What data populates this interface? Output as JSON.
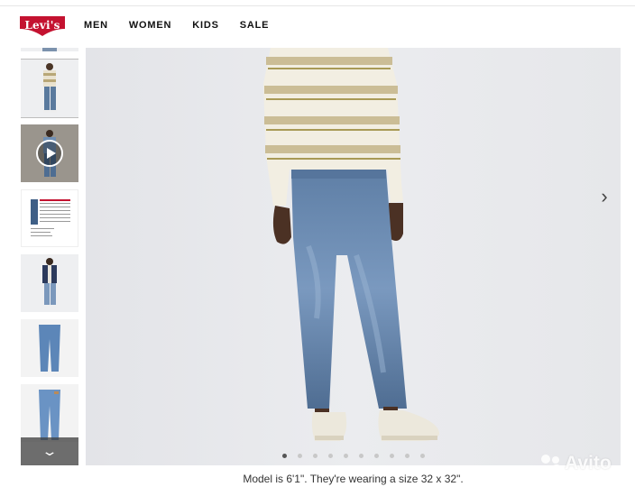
{
  "brand": {
    "logo_text": "Levi's",
    "logo_color": "#c41230"
  },
  "nav": {
    "items": [
      "MEN",
      "WOMEN",
      "KIDS",
      "SALE"
    ]
  },
  "gallery": {
    "thumbnails": [
      "model-front-full",
      "model-video",
      "size-chart",
      "model-jacket",
      "jeans-flat-front",
      "jeans-flat-back"
    ],
    "selected_index": 0,
    "dots_total": 10,
    "active_dot": 0,
    "next_icon": "›",
    "down_icon": "⌄"
  },
  "caption": "Model is 6'1\". They're wearing a size 32 x 32\".",
  "watermark": {
    "text": "Avito"
  }
}
